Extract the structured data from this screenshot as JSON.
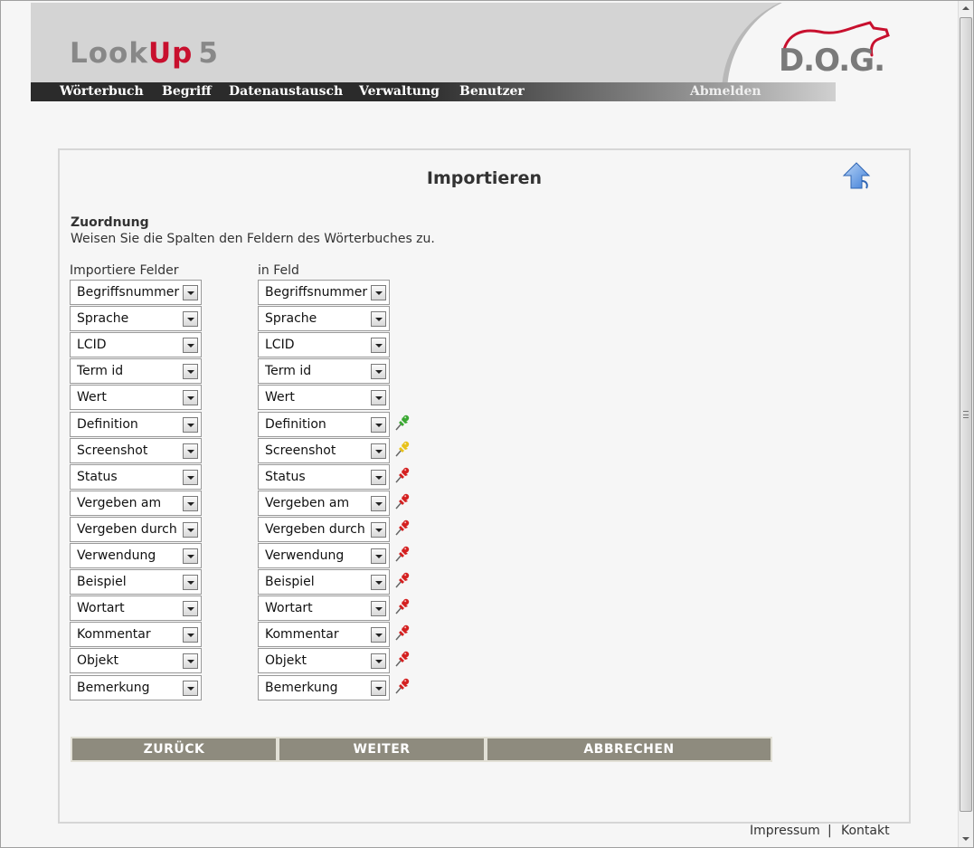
{
  "header": {
    "logo": {
      "look": "Look",
      "up": "Up",
      "version": "5"
    },
    "brand": "D.O.G."
  },
  "nav": {
    "items": [
      "Wörterbuch",
      "Begriff",
      "Datenaustausch",
      "Verwaltung",
      "Benutzer"
    ],
    "logout": "Abmelden"
  },
  "panel": {
    "title": "Importieren",
    "section_title": "Zuordnung",
    "section_desc": "Weisen Sie die Spalten den Feldern des Wörterbuches zu.",
    "col_source_label": "Importiere Felder",
    "col_target_label": "in Feld",
    "rows": [
      {
        "source": "Begriffsnummer",
        "target": "Begriffsnummer",
        "pin": ""
      },
      {
        "source": "Sprache",
        "target": "Sprache",
        "pin": ""
      },
      {
        "source": "LCID",
        "target": "LCID",
        "pin": ""
      },
      {
        "source": "Term id",
        "target": "Term id",
        "pin": ""
      },
      {
        "source": "Wert",
        "target": "Wert",
        "pin": ""
      },
      {
        "source": "Definition",
        "target": "Definition",
        "pin": "green"
      },
      {
        "source": "Screenshot",
        "target": "Screenshot",
        "pin": "yellow"
      },
      {
        "source": "Status",
        "target": "Status",
        "pin": "red"
      },
      {
        "source": "Vergeben am",
        "target": "Vergeben am",
        "pin": "red"
      },
      {
        "source": "Vergeben durch",
        "target": "Vergeben durch",
        "pin": "red"
      },
      {
        "source": "Verwendung",
        "target": "Verwendung",
        "pin": "red"
      },
      {
        "source": "Beispiel",
        "target": "Beispiel",
        "pin": "red"
      },
      {
        "source": "Wortart",
        "target": "Wortart",
        "pin": "red"
      },
      {
        "source": "Kommentar",
        "target": "Kommentar",
        "pin": "red"
      },
      {
        "source": "Objekt",
        "target": "Objekt",
        "pin": "red"
      },
      {
        "source": "Bemerkung",
        "target": "Bemerkung",
        "pin": "red"
      }
    ],
    "buttons": {
      "back": "ZURÜCK",
      "next": "WEITER",
      "cancel": "ABBRECHEN"
    }
  },
  "footer": {
    "impressum": "Impressum",
    "separator": "|",
    "kontakt": "Kontakt"
  },
  "colors": {
    "accent_red": "#c8102e",
    "button_bg": "#8e8b7e",
    "nav_bg": "#2b2b2b",
    "pin_green": "#3aa832",
    "pin_yellow": "#e8c21a",
    "pin_red": "#d42020"
  }
}
